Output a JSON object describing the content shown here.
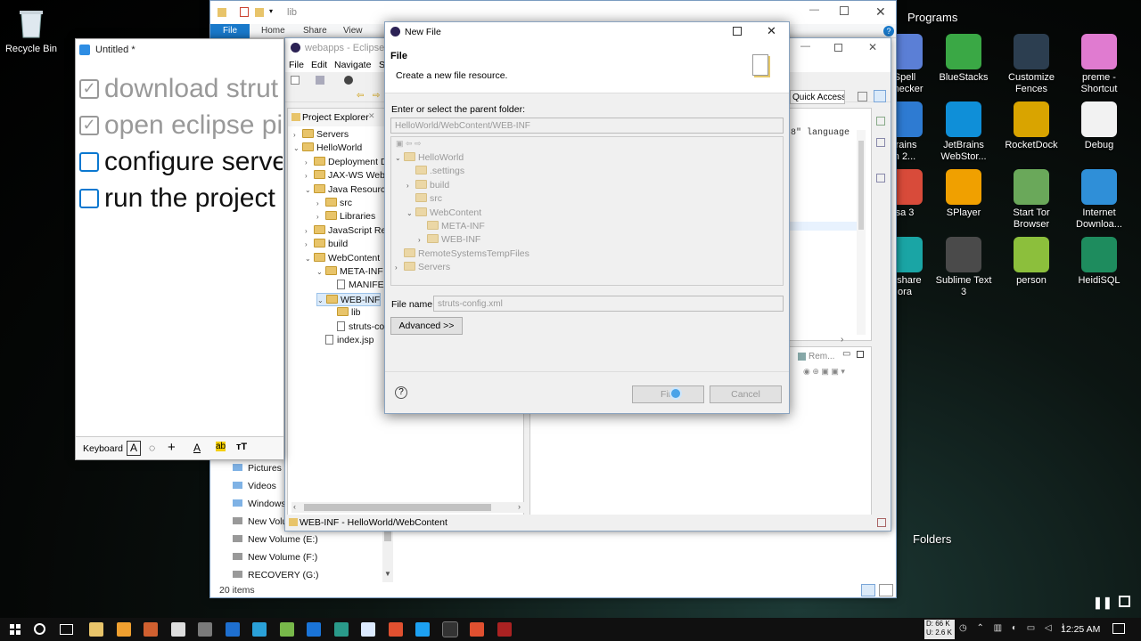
{
  "desktop": {
    "recycle_bin": "Recycle Bin",
    "fence_programs": "Programs",
    "fence_folders": "Folders",
    "icons": [
      {
        "label": "Spell\nChecker",
        "icon": "spell-icon",
        "color": "#5b7fd6"
      },
      {
        "label": "BlueStacks",
        "icon": "bluestacks-icon",
        "color": "#3aa845"
      },
      {
        "label": "Customize Fences",
        "icon": "fences-icon",
        "color": "#2c3e50"
      },
      {
        "label": "preme - Shortcut",
        "icon": "butterfly-icon",
        "color": "#e07bd0"
      },
      {
        "label": "trains\nn 2...",
        "icon": "l-icon",
        "color": "#2e7bd2"
      },
      {
        "label": "JetBrains WebStor...",
        "icon": "webstorm-icon",
        "color": "#0f8fd8"
      },
      {
        "label": "RocketDock",
        "icon": "rocketdock-icon",
        "color": "#d9a400"
      },
      {
        "label": "Debug",
        "icon": "file-icon",
        "color": "#f2f2f2"
      },
      {
        "label": "sa 3",
        "icon": "chrome-like-icon",
        "color": "#d84b3a"
      },
      {
        "label": "SPlayer",
        "icon": "splayer-icon",
        "color": "#f0a000"
      },
      {
        "label": "Start Tor Browser",
        "icon": "tor-icon",
        "color": "#6aa85a"
      },
      {
        "label": "Internet Downloa...",
        "icon": "idm-icon",
        "color": "#2f8fd8"
      },
      {
        "label": "ershare\nora",
        "icon": "ws-icon",
        "color": "#1aa5a5"
      },
      {
        "label": "Sublime Text 3",
        "icon": "sublime-icon",
        "color": "#4a4a4a"
      },
      {
        "label": "person",
        "icon": "person-icon",
        "color": "#8cbf3c"
      },
      {
        "label": "HeidiSQL",
        "icon": "heidisql-icon",
        "color": "#1e8c5e"
      }
    ]
  },
  "explorer": {
    "title": "lib",
    "ribbon_tabs": [
      "File",
      "Home",
      "Share",
      "View"
    ],
    "nav_items": [
      "Pictures",
      "Videos",
      "Windows",
      "New Volu",
      "New Volume (E:)",
      "New Volume (F:)",
      "RECOVERY (G:)"
    ],
    "status": "20 items"
  },
  "sticky": {
    "title": "Untitled *",
    "tasks": [
      {
        "text": "download strut",
        "done": true
      },
      {
        "text": "open eclipse pi",
        "done": true
      },
      {
        "text": "configure serve",
        "done": false
      },
      {
        "text": "run the project",
        "done": false
      }
    ],
    "keyboard_label": "Keyboard"
  },
  "eclipse": {
    "title": "webapps - Eclipse",
    "menu": [
      "File",
      "Edit",
      "Navigate",
      "Se"
    ],
    "quick_access": "Quick Access",
    "view_title": "Project Explorer",
    "tree": [
      {
        "label": "Servers",
        "indent": 0,
        "twisty": "›",
        "type": "folder"
      },
      {
        "label": "HelloWorld",
        "indent": 0,
        "twisty": "⌄",
        "type": "project"
      },
      {
        "label": "Deployment De",
        "indent": 1,
        "twisty": "›",
        "type": "folder"
      },
      {
        "label": "JAX-WS Web Se",
        "indent": 1,
        "twisty": "›",
        "type": "folder"
      },
      {
        "label": "Java Resources",
        "indent": 1,
        "twisty": "⌄",
        "type": "folder"
      },
      {
        "label": "src",
        "indent": 2,
        "twisty": "›",
        "type": "folder"
      },
      {
        "label": "Libraries",
        "indent": 2,
        "twisty": "›",
        "type": "folder"
      },
      {
        "label": "JavaScript Reso",
        "indent": 1,
        "twisty": "›",
        "type": "folder"
      },
      {
        "label": "build",
        "indent": 1,
        "twisty": "›",
        "type": "folder"
      },
      {
        "label": "WebContent",
        "indent": 1,
        "twisty": "⌄",
        "type": "folder"
      },
      {
        "label": "META-INF",
        "indent": 2,
        "twisty": "⌄",
        "type": "folder"
      },
      {
        "label": "MANIFEST",
        "indent": 3,
        "twisty": "",
        "type": "file"
      },
      {
        "label": "WEB-INF",
        "indent": 2,
        "twisty": "⌄",
        "type": "folder",
        "selected": true
      },
      {
        "label": "lib",
        "indent": 3,
        "twisty": "",
        "type": "folder"
      },
      {
        "label": "struts-con",
        "indent": 3,
        "twisty": "",
        "type": "file"
      },
      {
        "label": "index.jsp",
        "indent": 2,
        "twisty": "",
        "type": "file"
      }
    ],
    "editor_snippet": "8\" language",
    "bottom_tab": "Rem...",
    "status": "WEB-INF - HelloWorld/WebContent"
  },
  "dialog": {
    "title": "New File",
    "heading": "File",
    "description": "Create a new file resource.",
    "parent_label": "Enter or select the parent folder:",
    "parent_value": "HelloWorld/WebContent/WEB-INF",
    "tree": [
      {
        "label": "HelloWorld",
        "indent": 0,
        "twisty": "⌄"
      },
      {
        "label": ".settings",
        "indent": 1,
        "twisty": ""
      },
      {
        "label": "build",
        "indent": 1,
        "twisty": "›"
      },
      {
        "label": "src",
        "indent": 1,
        "twisty": ""
      },
      {
        "label": "WebContent",
        "indent": 1,
        "twisty": "⌄"
      },
      {
        "label": "META-INF",
        "indent": 2,
        "twisty": ""
      },
      {
        "label": "WEB-INF",
        "indent": 2,
        "twisty": "›"
      },
      {
        "label": "RemoteSystemsTempFiles",
        "indent": 0,
        "twisty": ""
      },
      {
        "label": "Servers",
        "indent": 0,
        "twisty": "›"
      }
    ],
    "filename_label": "File name:",
    "filename_value": "struts-config.xml",
    "advanced": "Advanced >>",
    "finish": "Fini",
    "cancel": "Cancel",
    "help": "?"
  },
  "taskbar": {
    "net_down": "D: 66 K",
    "net_up": "U: 2.6 K",
    "clock": "12:25 AM"
  }
}
